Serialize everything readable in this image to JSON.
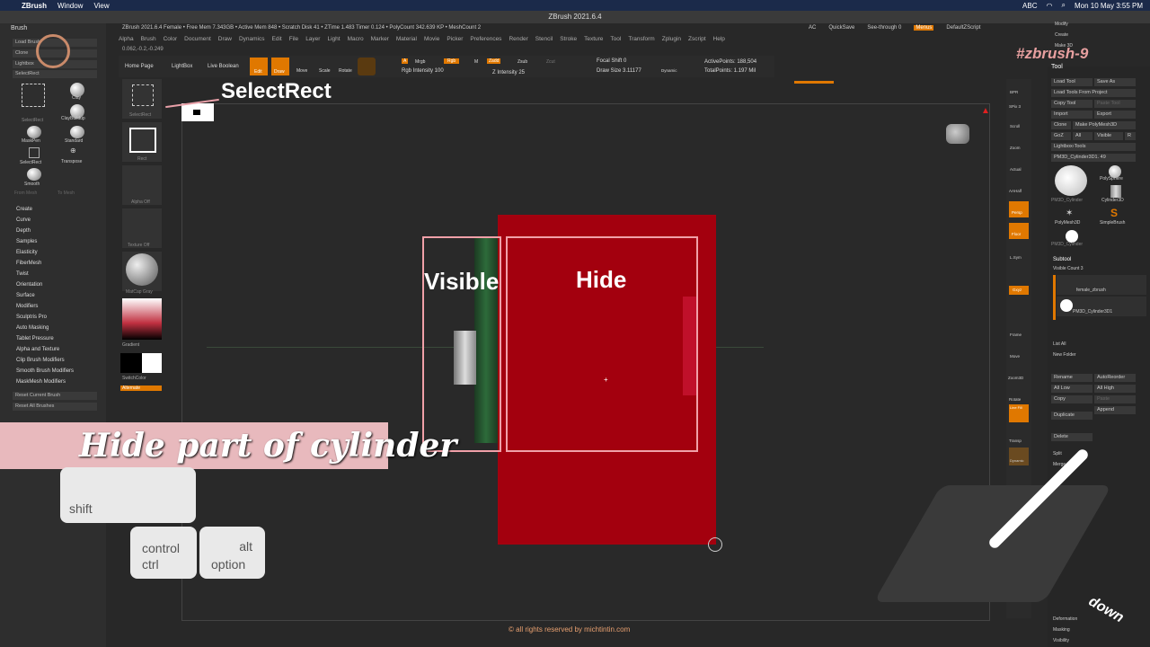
{
  "mac": {
    "app": "ZBrush",
    "menu_window": "Window",
    "menu_view": "View",
    "clock": "Mon 10 May 3:55 PM",
    "abc": "ABC"
  },
  "window_title": "ZBrush 2021.6.4",
  "top_info": "ZBrush 2021.6.4 Female  • Free Mem 7.343GB • Active Mem 848 • Scratch Disk 41 • ZTime 1.483 Timer 0.124 • PolyCount 342.639 KP • MeshCount 2",
  "coords": "0.062,-0.2,-0.249",
  "menus": [
    "Alpha",
    "Brush",
    "Color",
    "Document",
    "Draw",
    "Dynamics",
    "Edit",
    "File",
    "Layer",
    "Light",
    "Macro",
    "Marker",
    "Material",
    "Movie",
    "Picker",
    "Preferences",
    "Render",
    "Stencil",
    "Stroke",
    "Texture",
    "Tool",
    "Transform",
    "Zplugin",
    "Zscript",
    "Help"
  ],
  "top_right": {
    "quicksave": "QuickSave",
    "seethrough": "See-through 0",
    "menus": "Menus",
    "script": "DefaultZScript",
    "ac": "AC"
  },
  "toolbar": {
    "home": "Home Page",
    "lightbox": "LightBox",
    "live": "Live Boolean",
    "edit": "Edit",
    "draw": "Draw",
    "move": "Move",
    "scale": "Scale",
    "rotate": "Rotate",
    "mrgb": "Mrgb",
    "rgb": "Rgb",
    "m": "M",
    "a": "A",
    "zadd": "Zadd",
    "zsub": "Zsub",
    "zcut": "Zcut",
    "rgb_int": "Rgb Intensity 100",
    "z_int": "Z Intensity 25",
    "focal": "Focal Shift 0",
    "draw_size": "Draw Size 3.11177",
    "dynamic": "Dynamic",
    "active_pts": "ActivePoints: 188,504",
    "total_pts": "TotalPoints: 1.197 Mil"
  },
  "left": {
    "header": "Brush",
    "btns": [
      "Load Brush",
      "Clone",
      "Lightbox",
      "SelectRect"
    ],
    "brushes": [
      "Clay",
      "ClayBuildup",
      "MaskPen",
      "Standard",
      "SelectRect",
      "Transpose",
      "Smooth"
    ],
    "from_mesh": "From Mesh",
    "to_mesh": "To Mesh",
    "menu": [
      "Create",
      "Curve",
      "Depth",
      "Samples",
      "Elasticity",
      "FiberMesh",
      "Twist",
      "Orientation",
      "Surface",
      "Modifiers",
      "Sculptris Pro",
      "Auto Masking",
      "Tablet Pressure",
      "Alpha and Texture",
      "Clip Brush Modifiers",
      "Smooth Brush Modifiers",
      "MaskMesh Modifiers"
    ],
    "reset1": "Reset Current Brush",
    "reset2": "Reset All Brushes"
  },
  "shelf": {
    "selectrect": "SelectRect",
    "rect": "Rect",
    "alpha": "Alpha Off",
    "texture": "Texture Off",
    "matcap": "MatCap Gray",
    "gradient": "Gradient",
    "switch": "SwitchColor",
    "alternate": "Alternate"
  },
  "overlay": {
    "selectrect": "SelectRect",
    "visible": "Visible",
    "hide": "Hide",
    "banner": "Hide part of cylinder",
    "shift": "shift",
    "control": "control",
    "ctrl": "ctrl",
    "alt": "alt",
    "option": "option",
    "copyright": "© all rights reserved by michtintin.com",
    "zbrush9": "#zbrush-9",
    "down": "down"
  },
  "right": {
    "tool": "Tool",
    "modify": "Modify",
    "create": "Create",
    "makeit": "Make 3D",
    "load": "Load Tool",
    "saveas": "Save As",
    "loadproj": "Load Tools From Project",
    "copytool": "Copy Tool",
    "paste": "Paste Tool",
    "import": "Import",
    "export": "Export",
    "clone": "Clone",
    "makepm": "Make PolyMesh3D",
    "goz": "GoZ",
    "all": "All",
    "visible": "Visible",
    "r": "R",
    "lightbox": "Lightbox›Tools",
    "current": "PM3D_Cylinder3D1. 49",
    "polysphere": "PolySphere",
    "cyl": "Cylinder3D",
    "pm3dcyl": "PM3D_Cylinder",
    "polymesh": "PolyMesh3D",
    "simple": "SimpleBrush",
    "pm3dcyl2": "PM3D_Cylinder",
    "subtool": "Subtool",
    "vis_count": "Visible Count 3",
    "sub1": "female_zbrush",
    "sub2": "PM3D_Cylinder3D1",
    "listall": "List All",
    "newfolder": "New Folder",
    "rename": "Rename",
    "autoreorder": "AutoReorder",
    "alllow": "All Low",
    "allhigh": "All High",
    "copy": "Copy",
    "paste2": "Paste",
    "duplicate": "Duplicate",
    "append": "Append",
    "delete": "Delete",
    "split": "Split",
    "merge": "Merge",
    "deformation": "Deformation",
    "masking": "Masking",
    "visibility": "Visibility"
  },
  "strip": [
    "BPR",
    "SPix 3",
    "Scroll",
    "Zoom",
    "Actual",
    "AAHalf",
    "Persp",
    "Floor",
    "L.Sym",
    "Gxyz",
    "Frame",
    "Move",
    "Zoom3D",
    "Rotate",
    "Line Fill",
    "Transp",
    "Dynamic"
  ],
  "colors": {
    "accent": "#e07800",
    "red": "#a3000e",
    "pink": "#e8b9bd"
  }
}
